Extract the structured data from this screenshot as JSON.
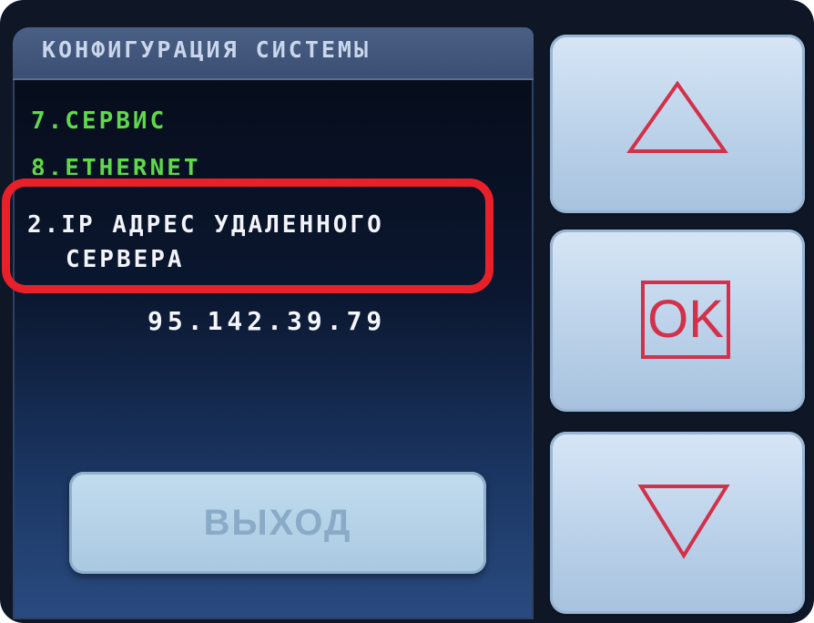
{
  "screen": {
    "title": "КОНФИГУРАЦИЯ СИСТЕМЫ",
    "items": [
      {
        "label": "7.СЕРВИС"
      },
      {
        "label": "8.ETHERNET"
      }
    ],
    "selected_item": {
      "line1": "2.IP АДРЕС УДАЛЕННОГО",
      "line2": "СЕРВЕРА"
    },
    "ip_value": "95.142.39.79",
    "exit_label": "ВЫХОД"
  },
  "side_buttons": {
    "up_icon": "up-triangle-icon",
    "ok_label": "OK",
    "down_icon": "down-triangle-icon"
  },
  "colors": {
    "menu_green": "#5fd84a",
    "highlight_red": "#e8202a",
    "icon_red": "#d3304a"
  }
}
